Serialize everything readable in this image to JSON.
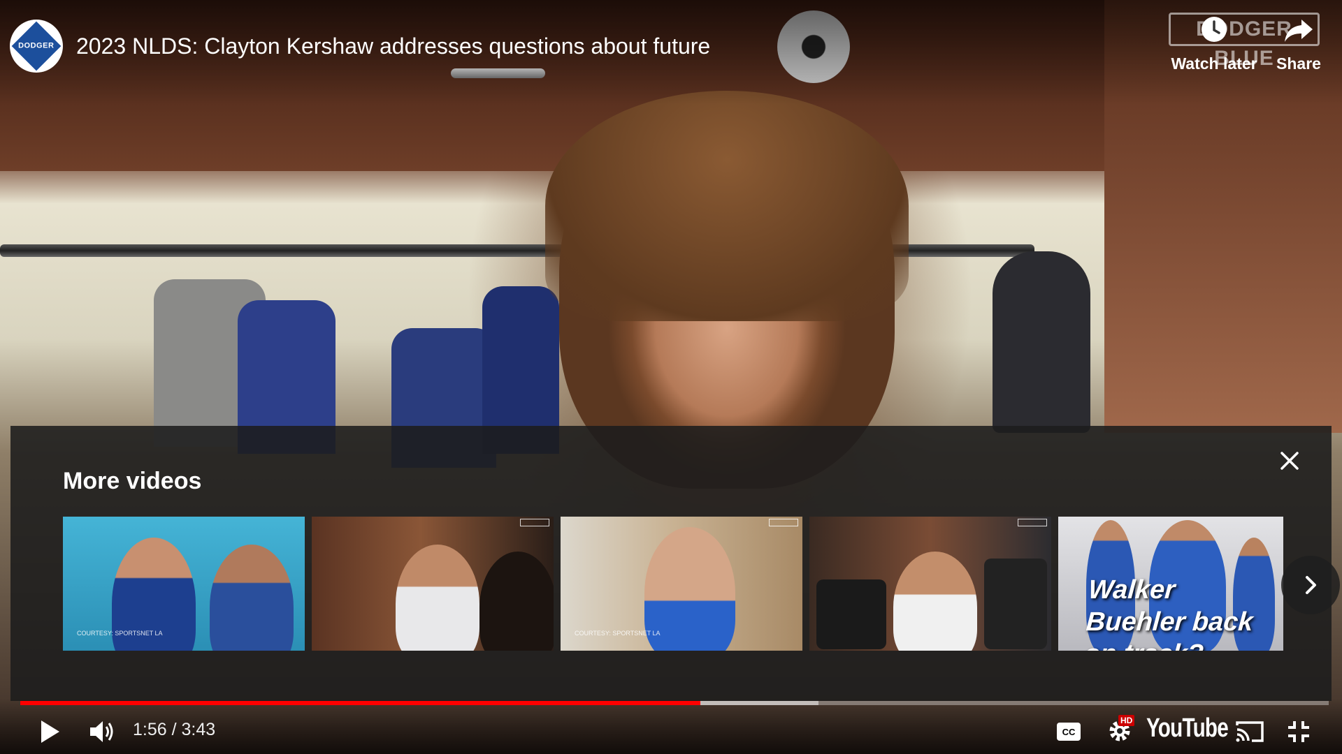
{
  "video": {
    "title": "2023 NLDS: Clayton Kershaw addresses questions about future",
    "channel_logo_text": "DODGER",
    "channel_logo_sub": "BLUE",
    "watermark_text": "DODGER BLUE"
  },
  "top_actions": {
    "watch_later_label": "Watch later",
    "watch_later_icon": "clock-icon",
    "share_label": "Share",
    "share_icon": "share-arrow-icon"
  },
  "more_videos": {
    "title": "More videos",
    "close_icon": "close-icon",
    "next_icon": "chevron-right-icon",
    "items": [
      {
        "thumb_kind": "press-conference",
        "credit": "COURTESY: SPORTSNET LA"
      },
      {
        "thumb_kind": "clubhouse-interview"
      },
      {
        "thumb_kind": "clubhouse-interview",
        "credit": "COURTESY: SPORTSNET LA"
      },
      {
        "thumb_kind": "clubhouse-media-scrum"
      },
      {
        "thumb_kind": "spring-training",
        "overlay_text": "Walker Buehler back on track?"
      }
    ]
  },
  "controls": {
    "current_time": "1:56",
    "duration": "3:43",
    "time_display": "1:56 / 3:43",
    "progress_fraction": 0.52,
    "buffered_fraction": 0.61,
    "play_icon": "play-icon",
    "volume_icon": "volume-icon",
    "cc_icon": "closed-captions-icon",
    "settings_icon": "settings-gear-icon",
    "settings_badge": "HD",
    "youtube_logo_text": "YouTube",
    "cast_icon": "cast-icon",
    "exit_fullscreen_icon": "exit-fullscreen-icon"
  },
  "colors": {
    "progress_played": "#ff0000",
    "settings_badge_bg": "#cc0000",
    "dodger_blue": "#1c4f9c"
  }
}
